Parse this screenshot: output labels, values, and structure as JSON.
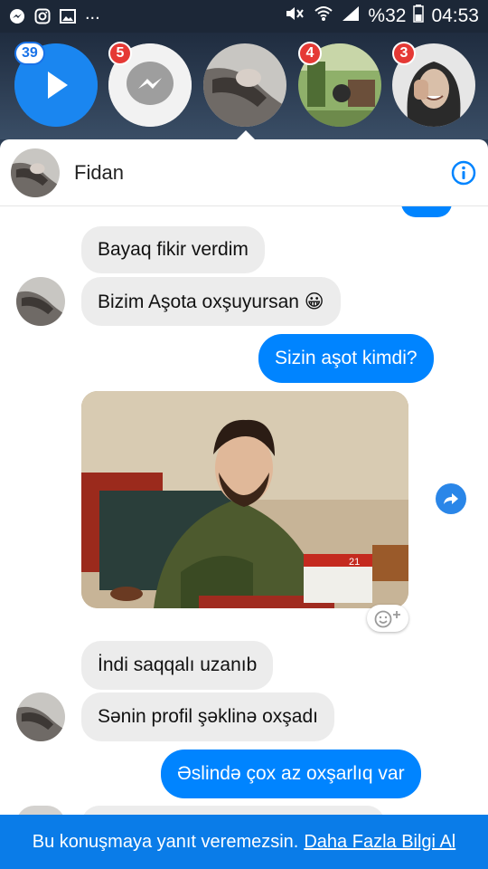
{
  "status_bar": {
    "left_icons": [
      "messenger-icon",
      "instagram-icon",
      "gallery-icon"
    ],
    "more": "...",
    "battery_percent": "%32",
    "time": "04:53"
  },
  "chat_heads": [
    {
      "kind": "play",
      "badge": "39"
    },
    {
      "kind": "messenger",
      "badge": "5"
    },
    {
      "kind": "user-fidan",
      "badge": ""
    },
    {
      "kind": "user-outdoor",
      "badge": "4"
    },
    {
      "kind": "user-girl",
      "badge": "3"
    }
  ],
  "conversation": {
    "name": "Fidan"
  },
  "messages": [
    {
      "dir": "in",
      "text": "Bayaq fikir verdim"
    },
    {
      "dir": "in",
      "text": "Bizim Aşota oxşuyursan 😀"
    },
    {
      "dir": "out",
      "text": "Sizin aşot kimdi?"
    },
    {
      "dir": "in",
      "text": "İndi saqqalı uzanıb"
    },
    {
      "dir": "in",
      "text": "Sənin profil şəklinə oxşadı"
    },
    {
      "dir": "out",
      "text": "Əslində çox az oxşarlıq var"
    }
  ],
  "photo_message": {
    "calendar_day": "21"
  },
  "bottom_bar": {
    "text": "Bu konuşmaya yanıt veremezsin.",
    "link": "Daha Fazla Bilgi Al"
  },
  "colors": {
    "accent": "#0084ff",
    "bottom_bar": "#0a7ce8",
    "badge_red": "#e53935"
  }
}
